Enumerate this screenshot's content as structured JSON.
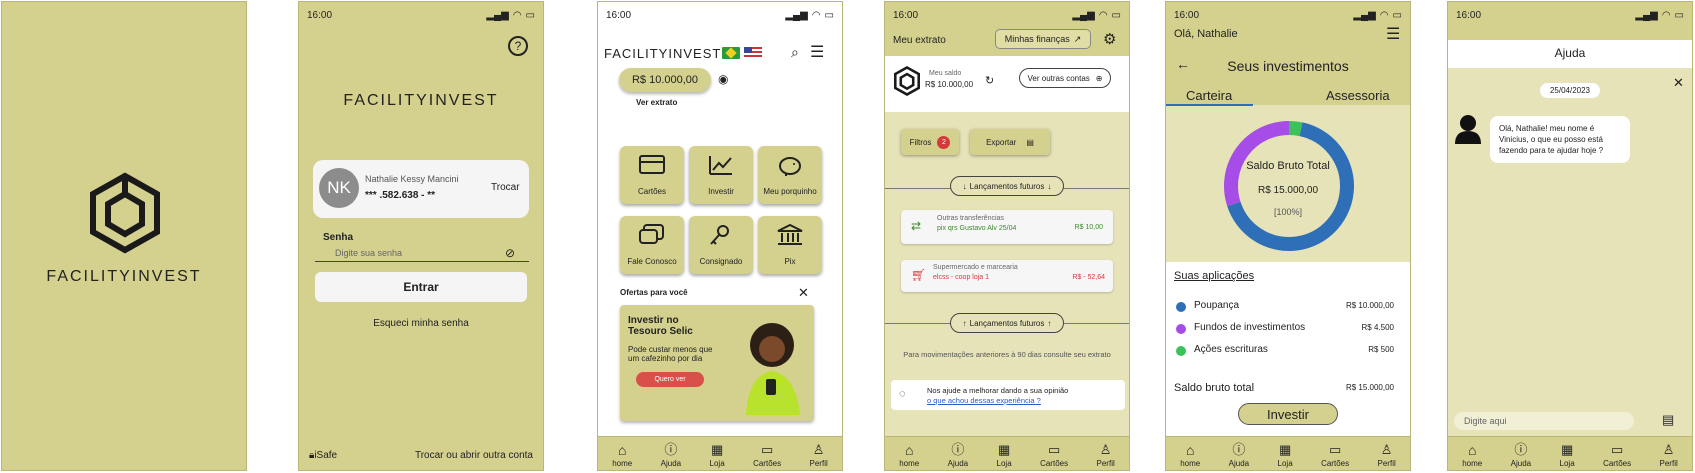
{
  "status_bar": {
    "time": "16:00"
  },
  "screen1": {
    "brand": "FACILITYINVEST"
  },
  "screen2": {
    "brand": "FACILITYINVEST",
    "avatar_initials": "NK",
    "user_name": "Nathalie Kessy Mancini",
    "user_doc": "*** .582.638 - **",
    "switch_label": "Trocar",
    "password_label": "Senha",
    "password_placeholder": "Digite sua senha",
    "login_button": "Entrar",
    "forgot_link": "Esqueci minha senha",
    "isafe_label": "iSafe",
    "switch_account_link": "Trocar ou abrir outra conta"
  },
  "screen3": {
    "brand": "FACILITYINVEST",
    "balance": "R$ 10.000,00",
    "statement_link": "Ver extrato",
    "tiles": [
      {
        "label": "Cartões",
        "icon": "card-icon"
      },
      {
        "label": "Investir",
        "icon": "chart-icon"
      },
      {
        "label": "Meu porquinho",
        "icon": "piggy-bank-icon"
      },
      {
        "label": "Fale Conosco",
        "icon": "chat-icon"
      },
      {
        "label": "Consignado",
        "icon": "key-icon"
      },
      {
        "label": "Pix",
        "icon": "bank-icon"
      }
    ],
    "offers_title": "Ofertas para você",
    "offer_title": "Investir no Tesouro Selic",
    "offer_text": "Pode custar menos que um cafezinho por dia",
    "offer_button": "Quero ver"
  },
  "screen4": {
    "header_title": "Meu extrato",
    "finance_button": "Minhas finanças",
    "balance_label": "Meu saldo",
    "balance_value": "R$ 10.000,00",
    "other_accounts_button": "Ver outras contas",
    "filter_button": "Filtros",
    "filter_count": "2",
    "export_button": "Exportar",
    "future_top": "Lançamentos futuros",
    "transactions": [
      {
        "title": "Outras transferências",
        "desc": "pix qrs Gustavo Alv 25/04",
        "amount": "R$ 10,00",
        "color": "#3a8a2a"
      },
      {
        "title": "Supermercado e marcearia",
        "desc": "elcss - coop loja 1",
        "amount": "R$ - 52,64",
        "color": "#d43a3a"
      }
    ],
    "future_bottom": "Lançamentos futuros",
    "older_note": "Para movimentações anteriores à 90 dias consulte seu extrato",
    "feedback_text": "Nos ajude a melhorar dando a sua opinião",
    "feedback_link": "o que achou dessas experiência ?"
  },
  "screen5": {
    "greeting": "Olá, Nathalie",
    "title": "Seus investimentos",
    "tab_wallet": "Carteira",
    "tab_advisory": "Assessoria",
    "donut_title": "Saldo Bruto Total",
    "donut_value": "R$ 15.000,00",
    "donut_pct": "[100%]",
    "apps_title": "Suas aplicações",
    "applications": [
      {
        "name": "Poupança",
        "value": "R$ 10.000,00",
        "color": "#2e6fb8",
        "share": 0.6667
      },
      {
        "name": "Fundos de investimentos",
        "value": "R$ 4.500",
        "color": "#a64de8",
        "share": 0.3
      },
      {
        "name": "Ações escrituras",
        "value": "R$ 500",
        "color": "#3cc25a",
        "share": 0.0333
      }
    ],
    "total_label": "Saldo bruto total",
    "total_value": "R$ 15.000,00",
    "invest_button": "Investir"
  },
  "screen6": {
    "title": "Ajuda",
    "date": "25/04/2023",
    "message": "Olá, Nathalie! meu nome é Vinicius, o que eu posso está fazendo para te ajudar hoje ?",
    "input_placeholder": "Digite aqui"
  },
  "nav": {
    "home": "home",
    "help": "Ajuda",
    "store": "Loja",
    "cards": "Cartões",
    "profile": "Perfil"
  }
}
